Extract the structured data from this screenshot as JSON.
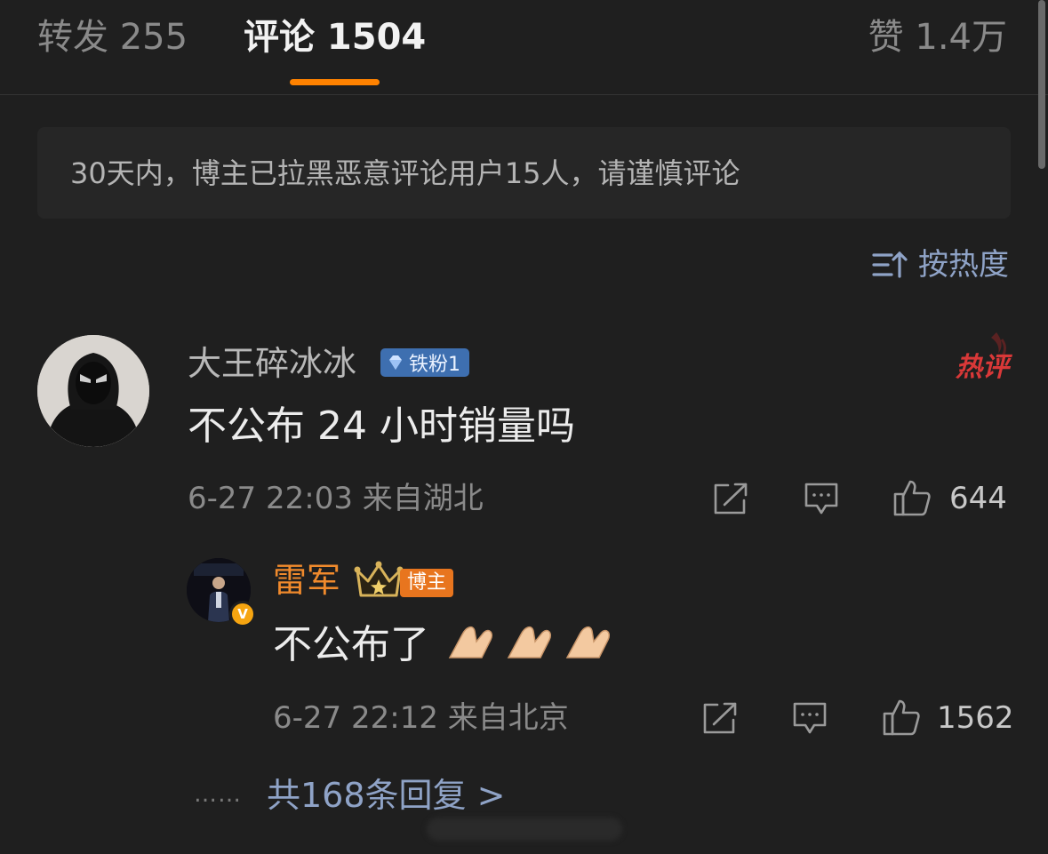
{
  "tabs": {
    "reposts": "转发 255",
    "comments": "评论 1504",
    "likes": "赞 1.4万"
  },
  "notice": "30天内，博主已拉黑恶意评论用户15人，请谨慎评论",
  "sort": {
    "label": "按热度",
    "icon": "sort-icon"
  },
  "comment": {
    "username": "大王碎冰冰",
    "fan_badge": "铁粉1",
    "hot_badge": "热评",
    "text": "不公布 24 小时销量吗",
    "meta": "6-27 22:03 来自湖北",
    "likes": "644"
  },
  "reply": {
    "username": "雷军",
    "verified_badge": "V",
    "author_badge": "博主",
    "text": "不公布了",
    "emoji": "pinch-hands-emoji x3",
    "meta": "6-27 22:12 来自北京",
    "likes": "1562"
  },
  "more_replies": {
    "dots": "……",
    "label": "共168条回复 >"
  },
  "colors": {
    "background": "#1f1f1f",
    "accent": "#ff8200",
    "link": "#8fa3c7",
    "author": "#f08a2c",
    "hot": "#d93838"
  }
}
